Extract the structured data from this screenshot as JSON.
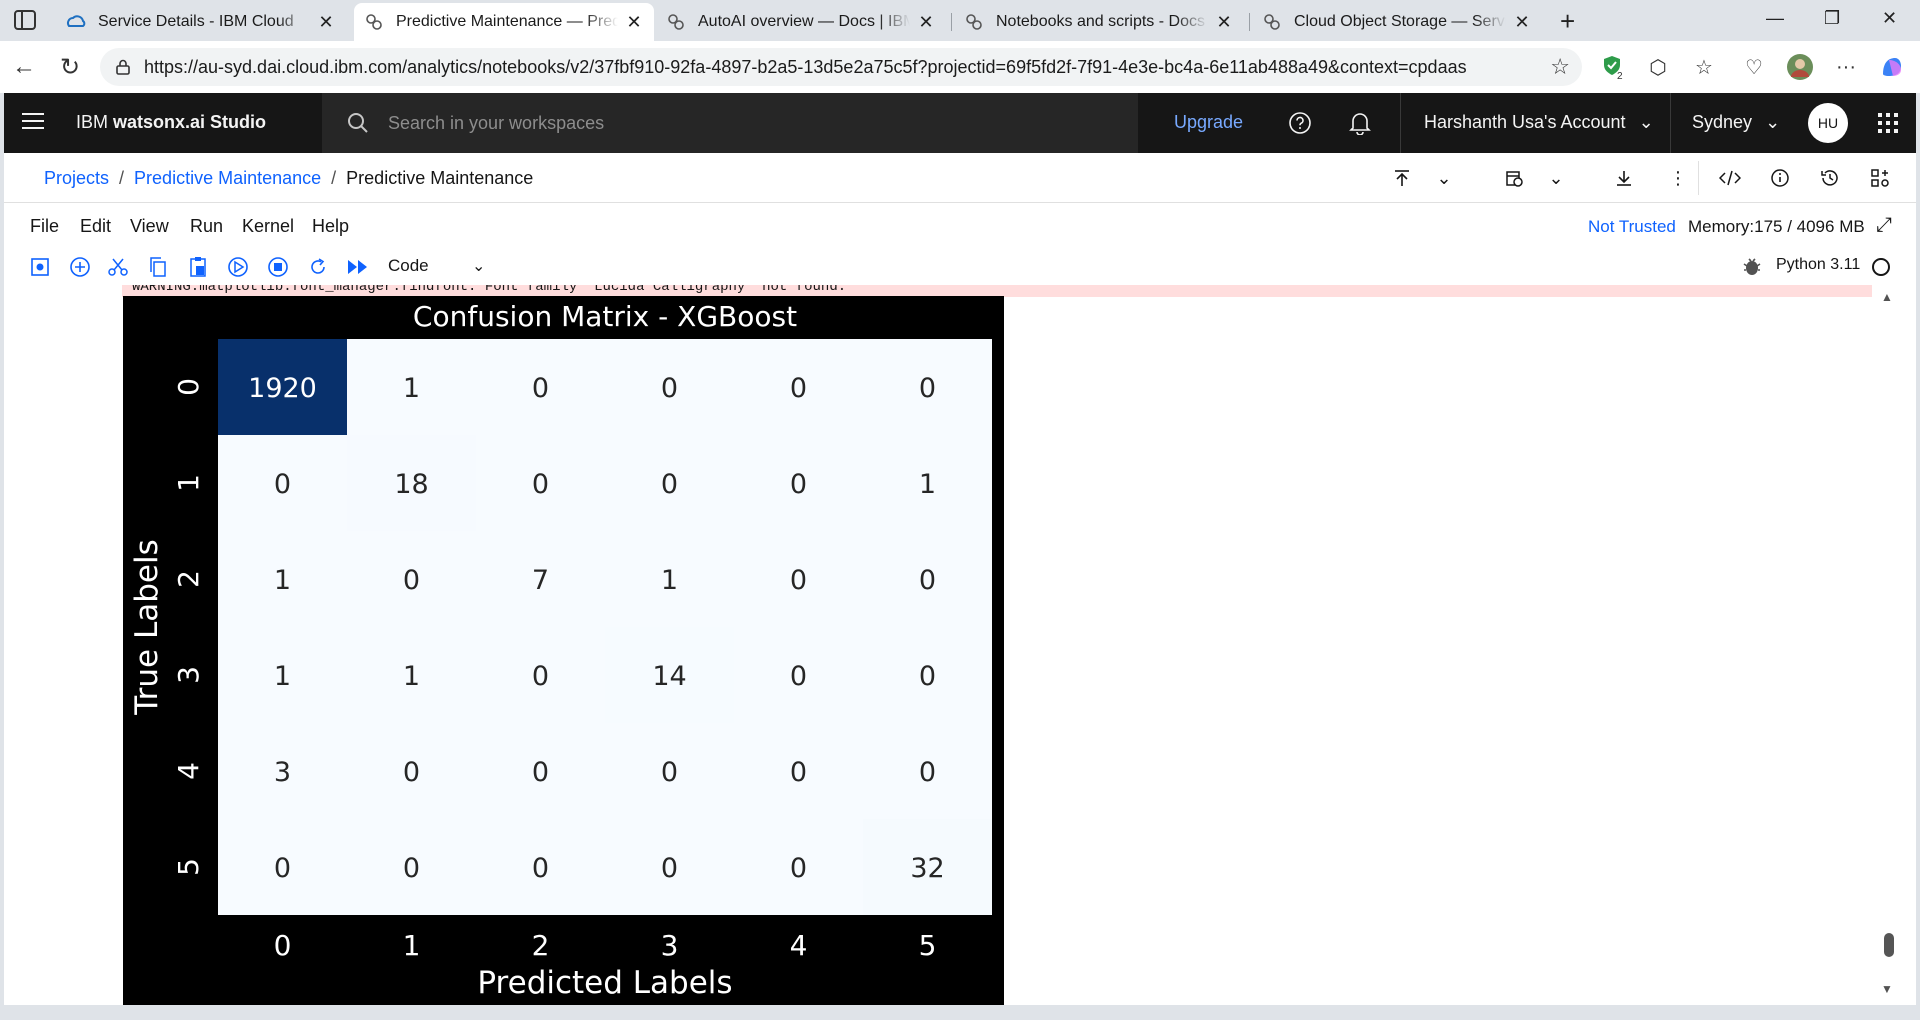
{
  "browser": {
    "tabs": [
      {
        "title": "Service Details - IBM Cloud",
        "active": false
      },
      {
        "title": "Predictive Maintenance — Predictive",
        "active": true
      },
      {
        "title": "AutoAI overview — Docs | IBM watsonx",
        "active": false
      },
      {
        "title": "Notebooks and scripts - Docs | IBM",
        "active": false
      },
      {
        "title": "Cloud Object Storage — Services",
        "active": false
      }
    ],
    "url": "https://au-syd.dai.cloud.ibm.com/analytics/notebooks/v2/37fbf910-92fa-4897-b2a5-13d5e2a75c5f?projectid=69f5fd2f-7f91-4e3e-bc4a-6e11ab488a49&context=cpdaas",
    "extension_badge": "2"
  },
  "header": {
    "brand_prefix": "IBM ",
    "brand_name": "watsonx.ai Studio",
    "search_placeholder": "Search in your workspaces",
    "upgrade_label": "Upgrade",
    "account_label": "Harshanth Usa's Account",
    "region_label": "Sydney",
    "avatar_initials": "HU"
  },
  "breadcrumb": {
    "items": [
      "Projects",
      "Predictive Maintenance",
      "Predictive Maintenance"
    ]
  },
  "notebook": {
    "menu": [
      "File",
      "Edit",
      "View",
      "Run",
      "Kernel",
      "Help"
    ],
    "trust_label": "Not Trusted",
    "memory_label": "Memory:175 / 4096 MB",
    "cell_type": "Code",
    "kernel_label": "Python 3.11",
    "warning_text": "WARNING:matplotlib.font_manager:findfont: Font family 'Lucida Calligraphy' not found."
  },
  "colors": {
    "link": "#0f62fe",
    "header_bg": "#161616",
    "heat_high": "#08306b",
    "heat_low": "#f7fbff"
  },
  "chart_data": {
    "type": "heatmap",
    "title": "Confusion Matrix - XGBoost",
    "xlabel": "Predicted Labels",
    "ylabel": "True Labels",
    "x_ticks": [
      "0",
      "1",
      "2",
      "3",
      "4",
      "5"
    ],
    "y_ticks": [
      "0",
      "1",
      "2",
      "3",
      "4",
      "5"
    ],
    "values": [
      [
        1920,
        1,
        0,
        0,
        0,
        0
      ],
      [
        0,
        18,
        0,
        0,
        0,
        1
      ],
      [
        1,
        0,
        7,
        1,
        0,
        0
      ],
      [
        1,
        1,
        0,
        14,
        0,
        0
      ],
      [
        3,
        0,
        0,
        0,
        0,
        0
      ],
      [
        0,
        0,
        0,
        0,
        0,
        32
      ]
    ],
    "colormap": "Blues",
    "colorbar": false
  }
}
